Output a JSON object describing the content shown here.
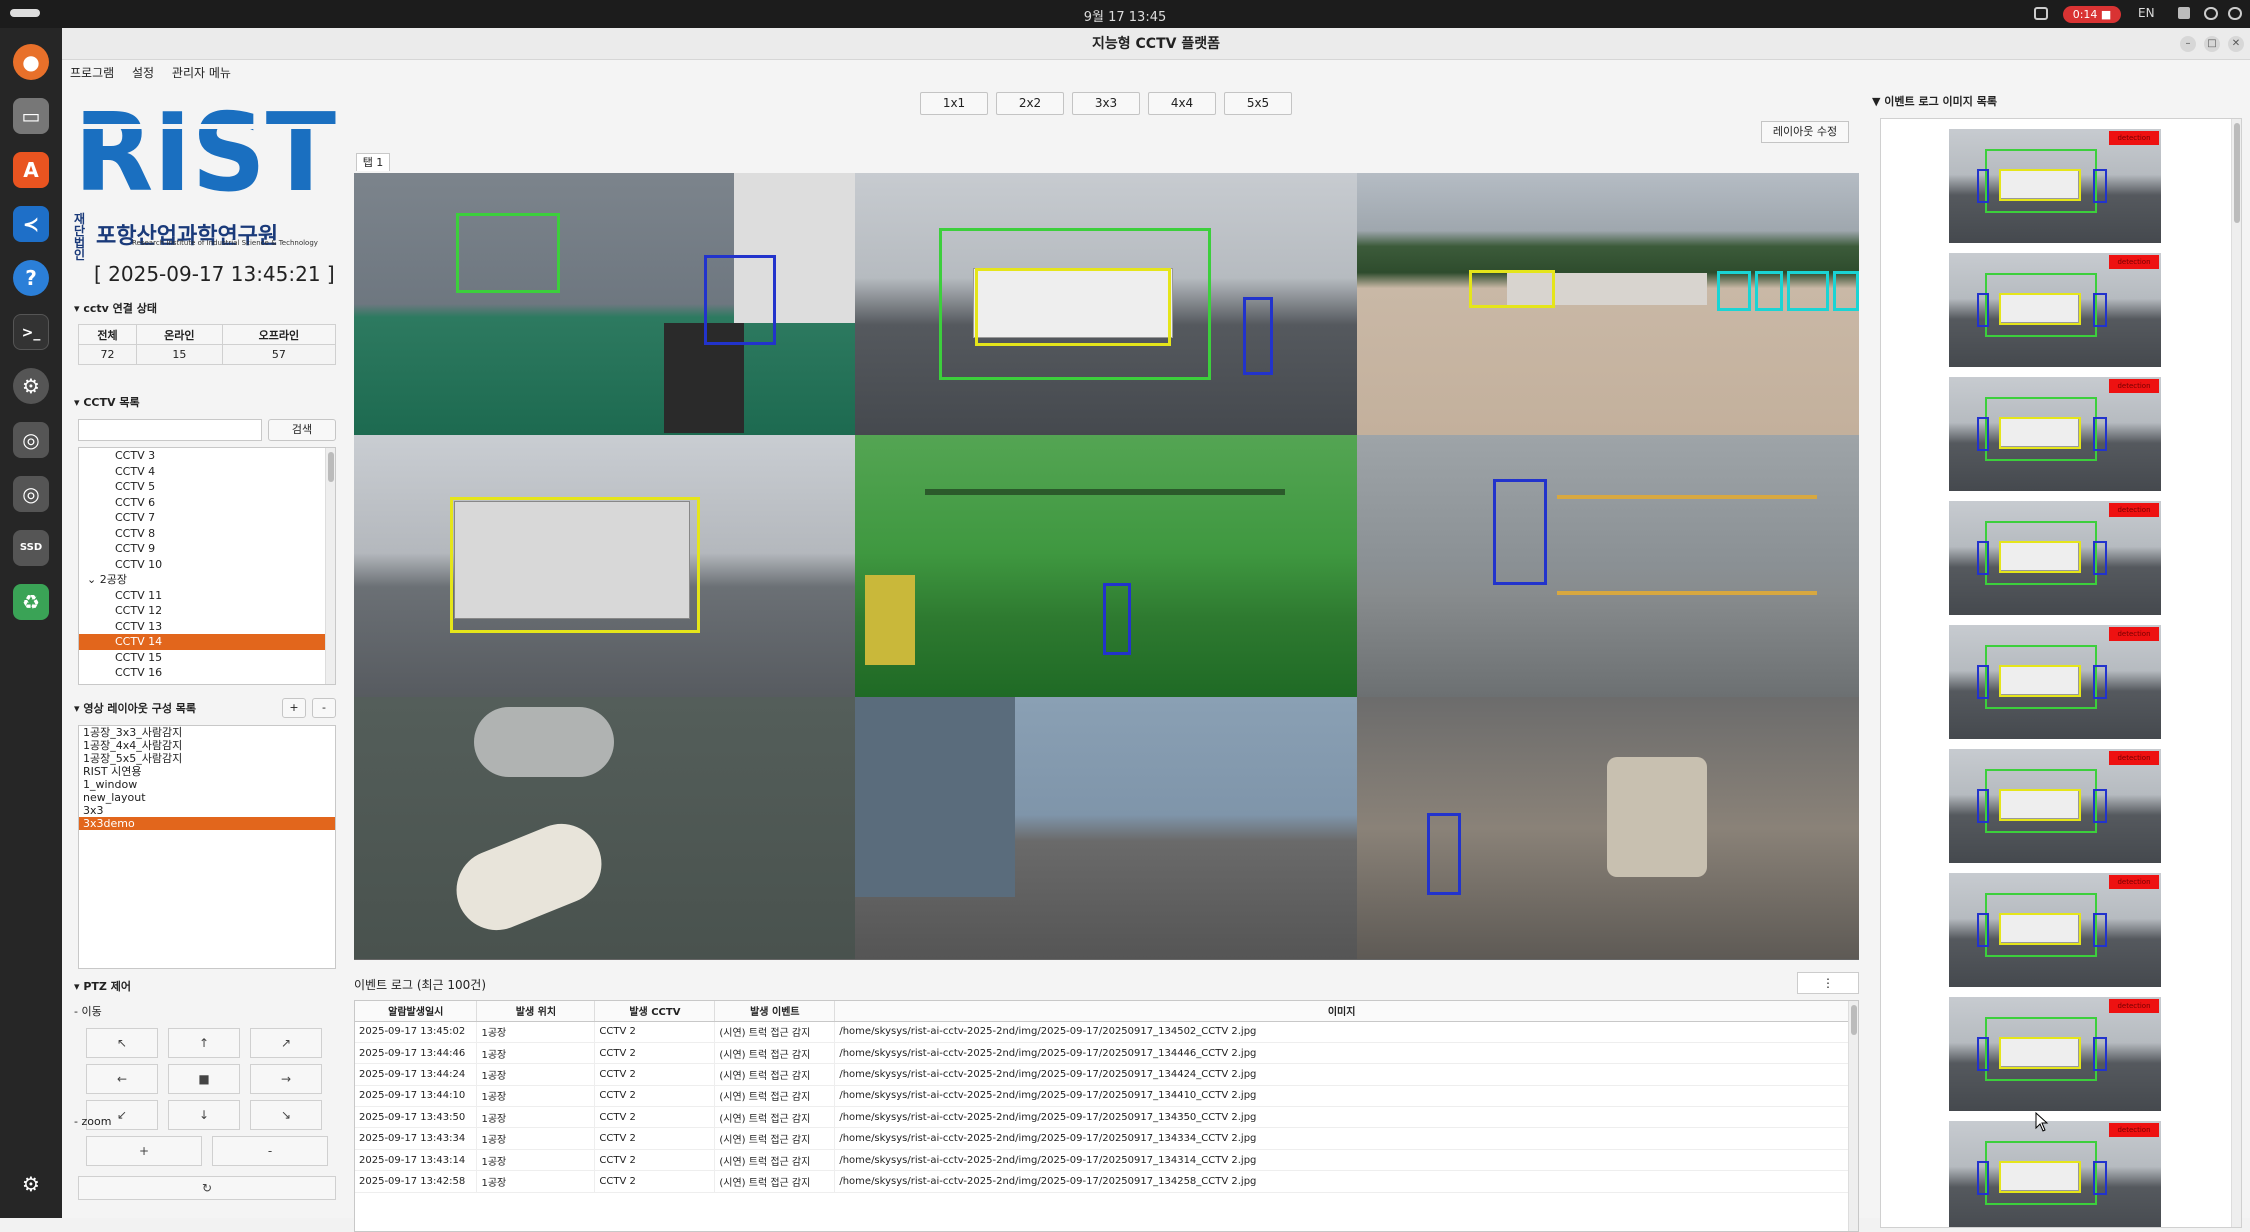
{
  "system": {
    "clock": "9월 17  13:45",
    "record_time": "0:14",
    "lang": "EN"
  },
  "dock": [
    "firefox-icon",
    "files-icon",
    "app-store-icon",
    "vscode-icon",
    "help-icon",
    "terminal-icon",
    "settings-icon",
    "disk-icon",
    "disk-icon",
    "ssd-icon",
    "trash-icon",
    "apps-grid-icon"
  ],
  "window": {
    "title": "지능형 CCTV 플랫폼"
  },
  "menu": [
    "프로그램",
    "설정",
    "관리자 메뉴"
  ],
  "logo": {
    "mark": "RIST",
    "name_ko": "재단법인 포항산업과학연구원",
    "prefix": "재단\n법인",
    "name_main": "포항산업과학연구원",
    "name_en": "Research Institute of Industrial Science & Technology"
  },
  "datetime": "[ 2025-09-17 13:45:21 ]",
  "connection": {
    "header": "▾ cctv 연결 상태",
    "cols": [
      "전체",
      "온라인",
      "오프라인"
    ],
    "values": [
      "72",
      "15",
      "57"
    ]
  },
  "cctv_list": {
    "header": "▾ CCTV 목록",
    "search_button": "검색",
    "items": [
      {
        "label": "CCTV 3",
        "type": "item"
      },
      {
        "label": "CCTV 4",
        "type": "item"
      },
      {
        "label": "CCTV 5",
        "type": "item"
      },
      {
        "label": "CCTV 6",
        "type": "item"
      },
      {
        "label": "CCTV 7",
        "type": "item"
      },
      {
        "label": "CCTV 8",
        "type": "item"
      },
      {
        "label": "CCTV 9",
        "type": "item"
      },
      {
        "label": "CCTV 10",
        "type": "item"
      },
      {
        "label": "⌄ 2공장",
        "type": "group"
      },
      {
        "label": "CCTV 11",
        "type": "item"
      },
      {
        "label": "CCTV 12",
        "type": "item"
      },
      {
        "label": "CCTV 13",
        "type": "item"
      },
      {
        "label": "CCTV 14",
        "type": "selected"
      },
      {
        "label": "CCTV 15",
        "type": "item"
      },
      {
        "label": "CCTV 16",
        "type": "item"
      }
    ]
  },
  "layouts": {
    "header": "▾ 영상 레이아웃 구성 목록",
    "add": "+",
    "remove": "-",
    "items": [
      {
        "label": "1공장_3x3_사람감지",
        "selected": false
      },
      {
        "label": "1공장_4x4_사람감지",
        "selected": false
      },
      {
        "label": "1공장_5x5_사람감지",
        "selected": false
      },
      {
        "label": "RIST 시연용",
        "selected": false
      },
      {
        "label": "1_window",
        "selected": false
      },
      {
        "label": "new_layout",
        "selected": false
      },
      {
        "label": "3x3",
        "selected": false
      },
      {
        "label": "3x3demo",
        "selected": true
      }
    ]
  },
  "ptz": {
    "header": "▾ PTZ 제어",
    "move_label": "- 이동",
    "zoom_label": "- zoom",
    "move_buttons": [
      "↖",
      "↑",
      "↗",
      "←",
      "■",
      "→",
      "↙",
      "↓",
      "↘"
    ],
    "zoom_in": "+",
    "zoom_out": "-",
    "reset": "↻"
  },
  "grid_buttons": [
    "1x1",
    "2x2",
    "3x3",
    "4x4",
    "5x5"
  ],
  "tab": "탭 1",
  "layout_edit": "레이아웃 수정",
  "event_log": {
    "title": "이벤트 로그 (최근 100건)",
    "more": "⋮",
    "cols": [
      "알람발생일시",
      "발생 위치",
      "발생 CCTV",
      "발생 이벤트",
      "이미지"
    ],
    "rows": [
      [
        "2025-09-17 13:45:02",
        "1공장",
        "CCTV 2",
        "(시연) 트럭 접근 감지",
        "/home/skysys/rist-ai-cctv-2025-2nd/img/2025-09-17/20250917_134502_CCTV 2.jpg"
      ],
      [
        "2025-09-17 13:44:46",
        "1공장",
        "CCTV 2",
        "(시연) 트럭 접근 감지",
        "/home/skysys/rist-ai-cctv-2025-2nd/img/2025-09-17/20250917_134446_CCTV 2.jpg"
      ],
      [
        "2025-09-17 13:44:24",
        "1공장",
        "CCTV 2",
        "(시연) 트럭 접근 감지",
        "/home/skysys/rist-ai-cctv-2025-2nd/img/2025-09-17/20250917_134424_CCTV 2.jpg"
      ],
      [
        "2025-09-17 13:44:10",
        "1공장",
        "CCTV 2",
        "(시연) 트럭 접근 감지",
        "/home/skysys/rist-ai-cctv-2025-2nd/img/2025-09-17/20250917_134410_CCTV 2.jpg"
      ],
      [
        "2025-09-17 13:43:50",
        "1공장",
        "CCTV 2",
        "(시연) 트럭 접근 감지",
        "/home/skysys/rist-ai-cctv-2025-2nd/img/2025-09-17/20250917_134350_CCTV 2.jpg"
      ],
      [
        "2025-09-17 13:43:34",
        "1공장",
        "CCTV 2",
        "(시연) 트럭 접근 감지",
        "/home/skysys/rist-ai-cctv-2025-2nd/img/2025-09-17/20250917_134334_CCTV 2.jpg"
      ],
      [
        "2025-09-17 13:43:14",
        "1공장",
        "CCTV 2",
        "(시연) 트럭 접근 감지",
        "/home/skysys/rist-ai-cctv-2025-2nd/img/2025-09-17/20250917_134314_CCTV 2.jpg"
      ],
      [
        "2025-09-17 13:42:58",
        "1공장",
        "CCTV 2",
        "(시연) 트럭 접근 감지",
        "/home/skysys/rist-ai-cctv-2025-2nd/img/2025-09-17/20250917_134258_CCTV 2.jpg"
      ]
    ]
  },
  "thumbnails": {
    "title": "▼ 이벤트 로그 이미지 목록",
    "count": 9,
    "tag": "detection"
  },
  "colors": {
    "accent": "#e2661c",
    "logo_blue": "#1a6fc0",
    "bbox_green": "#3ccf3c",
    "bbox_yellow": "#e5e51a",
    "bbox_blue": "#2233cc",
    "bbox_cyan": "#1ad4d4",
    "record_red": "#d93333"
  }
}
